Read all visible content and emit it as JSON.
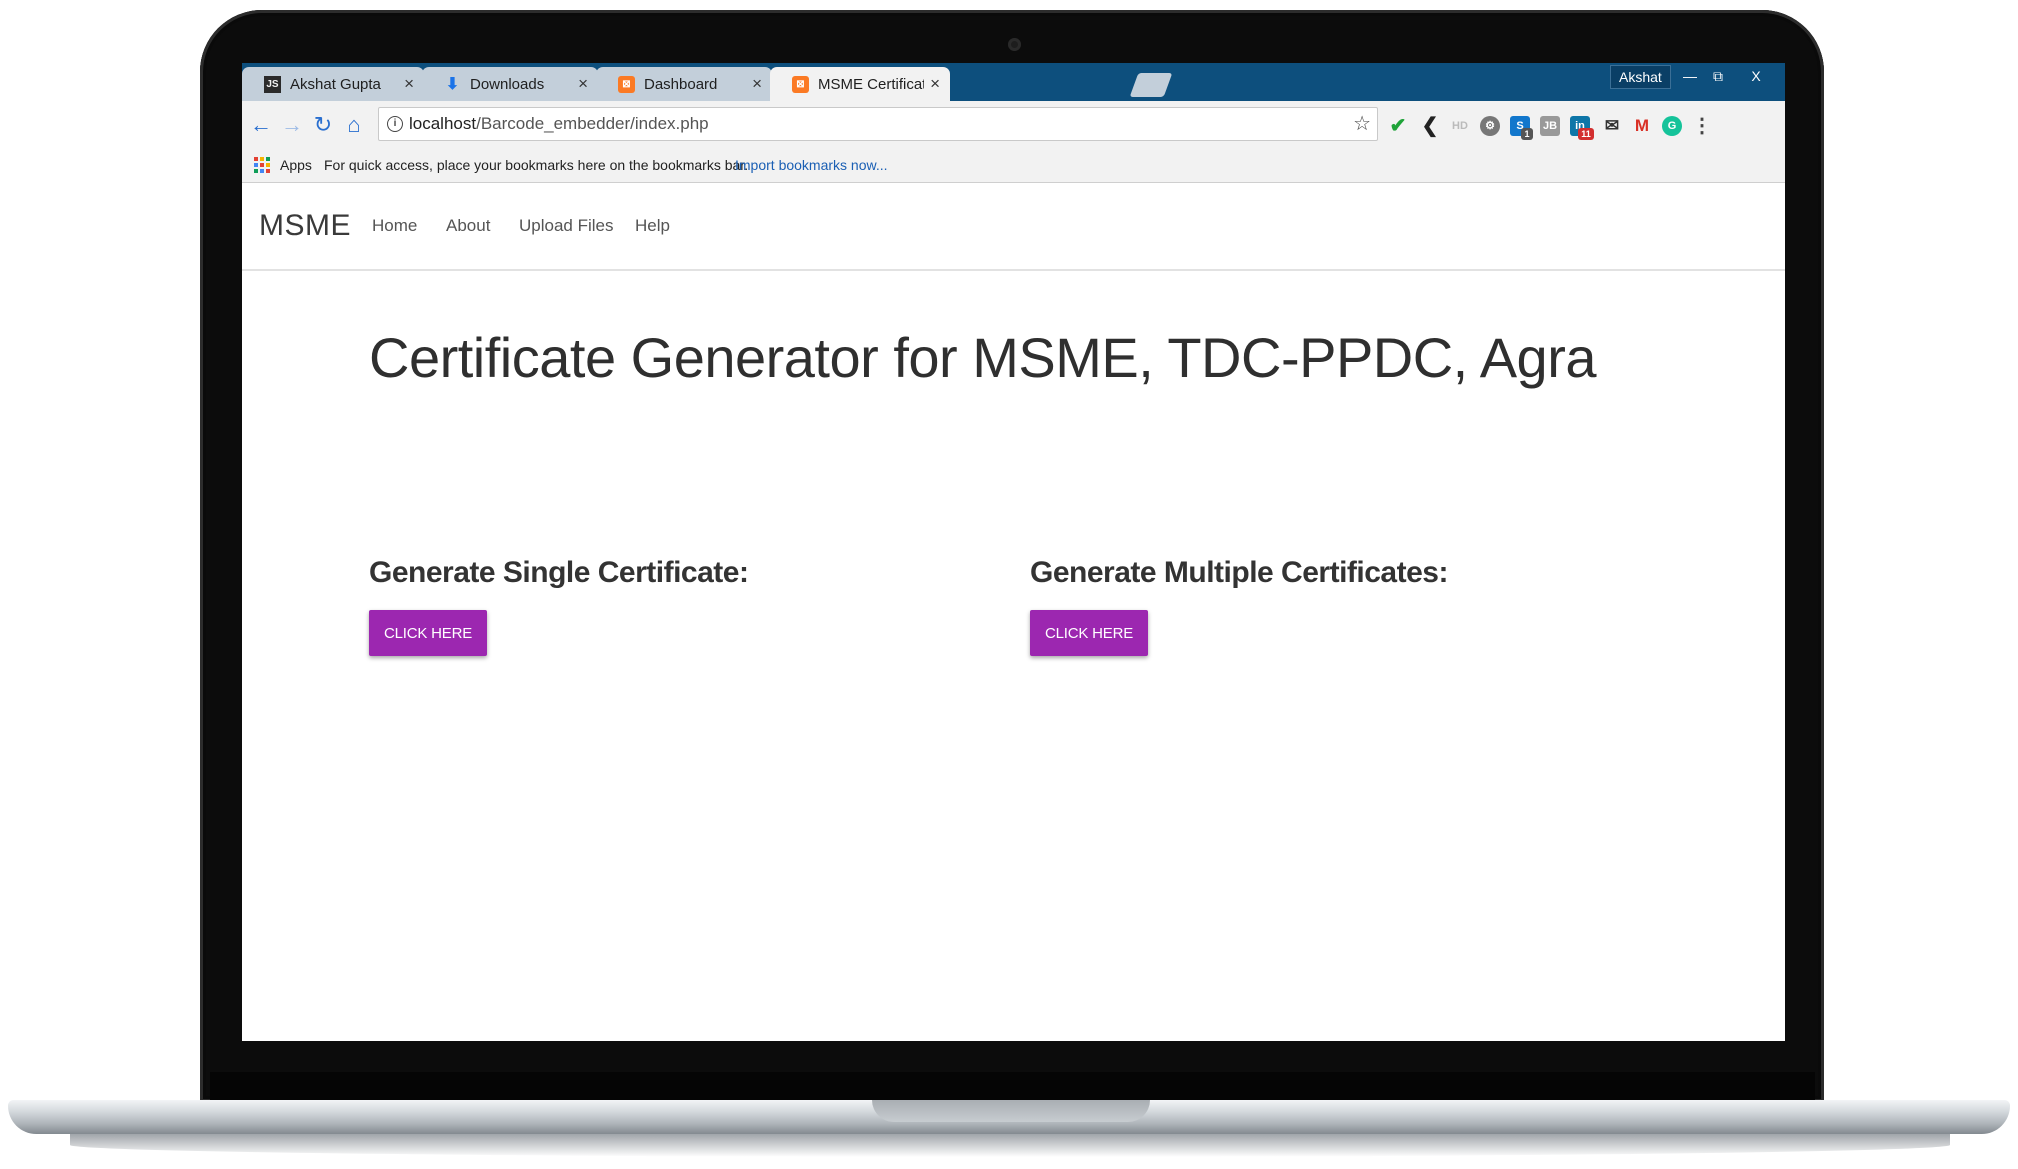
{
  "browser": {
    "tabs": [
      {
        "title": "Akshat Gupta",
        "icon": "js-icon",
        "active": false
      },
      {
        "title": "Downloads",
        "icon": "download-icon",
        "active": false
      },
      {
        "title": "Dashboard",
        "icon": "xampp-icon",
        "active": false
      },
      {
        "title": "MSME Certificate Generat",
        "icon": "xampp-icon",
        "active": true
      }
    ],
    "tab_close_glyph": "×",
    "profile_name": "Akshat",
    "window_controls": {
      "minimize": "—",
      "restore": "⧉",
      "close": "X"
    },
    "address": {
      "host": "localhost",
      "path": "/Barcode_embedder/index.php"
    },
    "extension_badges": {
      "skype": "1",
      "linkedin": "11"
    }
  },
  "bookmarks_bar": {
    "apps_label": "Apps",
    "hint": "For quick access, place your bookmarks here on the bookmarks bar.",
    "import_link": "Import bookmarks now..."
  },
  "navbar": {
    "brand": "MSME",
    "links": [
      "Home",
      "About",
      "Upload Files",
      "Help"
    ]
  },
  "main": {
    "title": "Certificate Generator for MSME, TDC-PPDC, Agra",
    "single": {
      "heading": "Generate Single Certificate:",
      "button": "CLICK HERE"
    },
    "multiple": {
      "heading": "Generate Multiple Certificates:",
      "button": "CLICK HERE"
    }
  },
  "colors": {
    "button": "#9c27b0",
    "tab_strip": "#0d4f7d",
    "link": "#1a5fb4"
  }
}
